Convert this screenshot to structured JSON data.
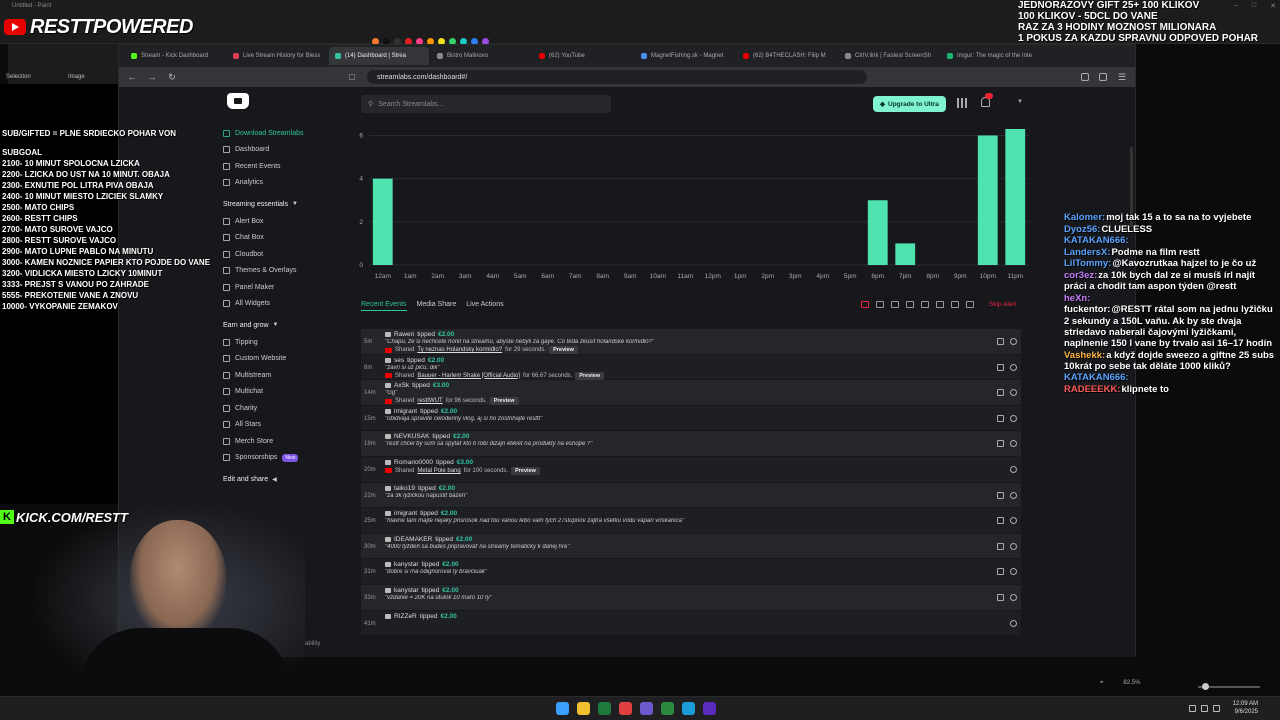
{
  "paint": {
    "title": "Untitled - Paint",
    "tools_label_selection": "Selection",
    "tools_label_image": "Image",
    "zoom": "82.5%",
    "swatches": [
      "#ff7a30",
      "#111111",
      "#333333",
      "#e02020",
      "#ff3b8a",
      "#ff9500",
      "#f5e11a",
      "#37d26b",
      "#1ec9c9",
      "#2f7cf6",
      "#9b4ae2"
    ]
  },
  "overlay": {
    "logo_text": "RESTTPOWERED",
    "top_right": [
      "JEDNORAZOVY GIFT 25+ 100 KLIKOV",
      "100 KLIKOV - 5DCL DO VANE",
      "RAZ ZA 3 HODINY MOZNOST MILIONARA",
      "1 POKUS ZA KAZDU SPRAVNU ODPOVED  POHAR DNU"
    ],
    "left_title": "SUB/GIFTED = PLNE SRDIECKO POHAR VON",
    "left_subgoal": "SUBGOAL",
    "left_goals": [
      "2100- 10 MINUT SPOLOCNA LZICKA",
      "2200- LZICKA DO UST NA 10 MINUT. OBAJA",
      "2300- EXNUTIE POL LITRA PIVA OBAJA",
      "2400- 10 MINUT MIESTO LZICIEK SLAMKY",
      "2500- MATO CHIPS",
      "2600- RESTT CHIPS",
      "2700- MATO SUROVE VAJCO",
      "2800- RESTT SUROVE VAJCO",
      "2900- MATO LUPNE PABLO NA MINUTU",
      "3000-  KAMEN NOZNICE PAPIER KTO POJDE DO VANE",
      "3200-  VIDLICKA MIESTO LZICKY 10MINUT",
      "3333- PREJST S VANOU PO ZAHRADE",
      "5555- PREKOTENIE VANE A ZNOVU",
      "10000- VYKOPANIE ZEMAKOV"
    ],
    "kick_k": "K",
    "kick_text": "KICK.COM/RESTT"
  },
  "browser": {
    "tabs": [
      {
        "label": "Stream - Kick Dashboard",
        "color": "#53fc18",
        "active": false
      },
      {
        "label": "Live Stream History for Bless",
        "color": "#e23b5b",
        "active": false
      },
      {
        "label": "(14) Dashboard | Strea",
        "color": "#31c3a2",
        "active": true
      },
      {
        "label": "Bistro Malinovo",
        "color": "#888888",
        "active": false
      },
      {
        "label": "(62) YouTube",
        "color": "#e00000",
        "active": false
      },
      {
        "label": "MagnetFishing.sk - Magnet",
        "color": "#4a8cf0",
        "active": false
      },
      {
        "label": "(62) B4THECLASH: Filip M",
        "color": "#e00000",
        "active": false
      },
      {
        "label": "CtrlV.link | Fastest ScreenSh",
        "color": "#888888",
        "active": false
      },
      {
        "label": "Imgur: The magic of the Inte",
        "color": "#1bb76e",
        "active": false
      }
    ],
    "url": "streamlabs.com/dashboard#/"
  },
  "streamlabs": {
    "search_placeholder": "Search Streamlabs...",
    "upgrade_label": "Upgrade to Ultra",
    "sidebar_top": [
      {
        "label": "Download Streamlabs",
        "accent": true
      },
      {
        "label": "Dashboard",
        "accent": false
      },
      {
        "label": "Recent Events",
        "accent": false
      },
      {
        "label": "Analytics",
        "accent": false
      }
    ],
    "section_streaming": "Streaming essentials",
    "sidebar_streaming": [
      "Alert Box",
      "Chat Box",
      "Cloudbot",
      "Themes & Overlays",
      "Panel Maker",
      "All Widgets"
    ],
    "section_earn": "Earn and grow",
    "sidebar_earn": [
      "Tipping",
      "Custom Website",
      "Multistream",
      "Multichat",
      "Charity",
      "All Stars",
      "Merch Store",
      "Sponsorships"
    ],
    "new_badge": "New",
    "section_edit": "Edit and share",
    "bility": "ability",
    "event_tabs": [
      "Recent Events",
      "Media Share",
      "Live Actions"
    ],
    "skip_alert": "Skip Alert",
    "events": [
      {
        "time": "5m",
        "user": "Rawen",
        "amount": "€2.00",
        "message": "\"Chápu, že si nechcete honit na streamu, abyste nebyli za gaye. Co teda zkusit holandské kormidlo?\"",
        "shared": "Ty neznas Holandsky kormidlo?",
        "duration": "for 29 seconds.",
        "preview": "Preview"
      },
      {
        "time": "8m",
        "user": "ses",
        "amount": "€2.00",
        "message": "\"zavri si uz piču, dik\"",
        "shared": "Bauuer - Harlem Shake [Official Audio]",
        "duration": "for 66.67 seconds.",
        "preview": "Preview"
      },
      {
        "time": "14m",
        "user": "AxSk",
        "amount": "€3.00",
        "message": "\"Gg\"",
        "shared": "resttWUT",
        "duration": "for 96 seconds.",
        "preview": "Preview"
      },
      {
        "time": "15m",
        "user": "imigrant",
        "amount": "€2.00",
        "message": "\"obidvaja spravite celodenny vlog, aj si ho zostrihajte resttt\"",
        "shared": "",
        "duration": "",
        "preview": ""
      },
      {
        "time": "18m",
        "user": "NEVKUSAK",
        "amount": "€2.00",
        "message": "\"restt chcel by som sa spýtať kto ti robí dizajn etikiet na produkty na eshope ?\"",
        "shared": "",
        "duration": "",
        "preview": ""
      },
      {
        "time": "20m",
        "user": "Romario0000",
        "amount": "€3.00",
        "message": "",
        "shared": "Metal Pole bang",
        "duration": "for 100 seconds.",
        "preview": "Preview"
      },
      {
        "time": "22m",
        "user": "taiko19",
        "amount": "€2.00",
        "message": "\"za 3k lyžičkou napustit bazen\"",
        "shared": "",
        "duration": "",
        "preview": ""
      },
      {
        "time": "25m",
        "user": "imigrant",
        "amount": "€2.00",
        "message": "\"hlavne tam majte nejaky prisrosok nad tou vanou lebo vam tych 27stupnov zajtra všetku vodu vapari vriskanica\"",
        "shared": "",
        "duration": "",
        "preview": ""
      },
      {
        "time": "30m",
        "user": "IDEAMAKER",
        "amount": "€2.00",
        "message": "\"4000 týždeň sa budeš pripravovať na streamy tematicky k danej hre\"",
        "shared": "",
        "duration": "",
        "preview": ""
      },
      {
        "time": "31m",
        "user": "kanystar",
        "amount": "€2.00",
        "message": "\"dobre si ma odignoroval ty bravčiuak\"",
        "shared": "",
        "duration": "",
        "preview": ""
      },
      {
        "time": "33m",
        "user": "kanystar",
        "amount": "€2.00",
        "message": "\"vzdanie = 20K na útulok 10 mařo 10 ty\"",
        "shared": "",
        "duration": "",
        "preview": ""
      },
      {
        "time": "41m",
        "user": "RIZZeR",
        "amount": "€2.00",
        "message": "",
        "shared": "",
        "duration": "",
        "preview": ""
      }
    ],
    "shared_prefix": "Shared",
    "tipped_word": "tipped"
  },
  "chart_data": {
    "type": "bar",
    "categories": [
      "12am",
      "1am",
      "2am",
      "3am",
      "4am",
      "5am",
      "6am",
      "7am",
      "8am",
      "9am",
      "10am",
      "11am",
      "12pm",
      "1pm",
      "2pm",
      "3pm",
      "4pm",
      "5pm",
      "6pm",
      "7pm",
      "8pm",
      "9pm",
      "10pm",
      "11pm"
    ],
    "values": [
      4,
      0,
      0,
      0,
      0,
      0,
      0,
      0,
      0,
      0,
      0,
      0,
      0,
      0,
      0,
      0,
      0,
      0,
      3,
      1,
      0,
      0,
      6,
      6.3
    ],
    "ylim": [
      0,
      6.3
    ],
    "yticks": [
      0,
      2,
      4,
      6
    ],
    "bar_color": "#4fe3b0",
    "grid": true
  },
  "chat": [
    {
      "user": "Kalomer:",
      "color": "#5aa2ff",
      "text": "moj tak 15 a to sa na to vyjebete"
    },
    {
      "user": "Dyoz56:",
      "color": "#5aa2ff",
      "text": "CLUELESS"
    },
    {
      "user": "KATAKAN666:",
      "color": "#5aa2ff",
      "text": ""
    },
    {
      "user": "LandersX:",
      "color": "#5aa2ff",
      "text": "Podme na film restt"
    },
    {
      "user": "LilTommy:",
      "color": "#5aa2ff",
      "text": "@Kavozrutkaa hajzel to je čo už"
    },
    {
      "user": "cor3ez:",
      "color": "#c77dff",
      "text": "za 10k bych dal ze si musíš írl najít práci a chodit tam aspon týden @restt"
    },
    {
      "user": "heXn:",
      "color": "#c77dff",
      "text": ""
    },
    {
      "user": "fuckentor:",
      "color": "#ffffff",
      "text": "@RESTT rátal som na jednu lyžičku 2 sekundy a 150L vaňu. Ak by ste dvaja striedavo naberali čajovými lyžičkami, naplnenie 150 l vane by trvalo asi 16–17 hodín"
    },
    {
      "user": "Vashekk:",
      "color": "#ffb347",
      "text": "a když dojde sweezo a giftne 25 subs 10krát po sebe tak děláte 1000 kliků?"
    },
    {
      "user": "KATAKAN666:",
      "color": "#5aa2ff",
      "text": ""
    },
    {
      "user": "RADEEEKK:",
      "color": "#ff5a5a",
      "text": "klipnete to"
    }
  ],
  "taskbar": {
    "time": "12:09 AM",
    "date": "9/6/2025",
    "icons": [
      "#3aa0ff",
      "#f0c030",
      "#1e7a3c",
      "#e04040",
      "#6a5acd",
      "#2b8a3e",
      "#1b9bd7",
      "#5b2bc0"
    ]
  }
}
